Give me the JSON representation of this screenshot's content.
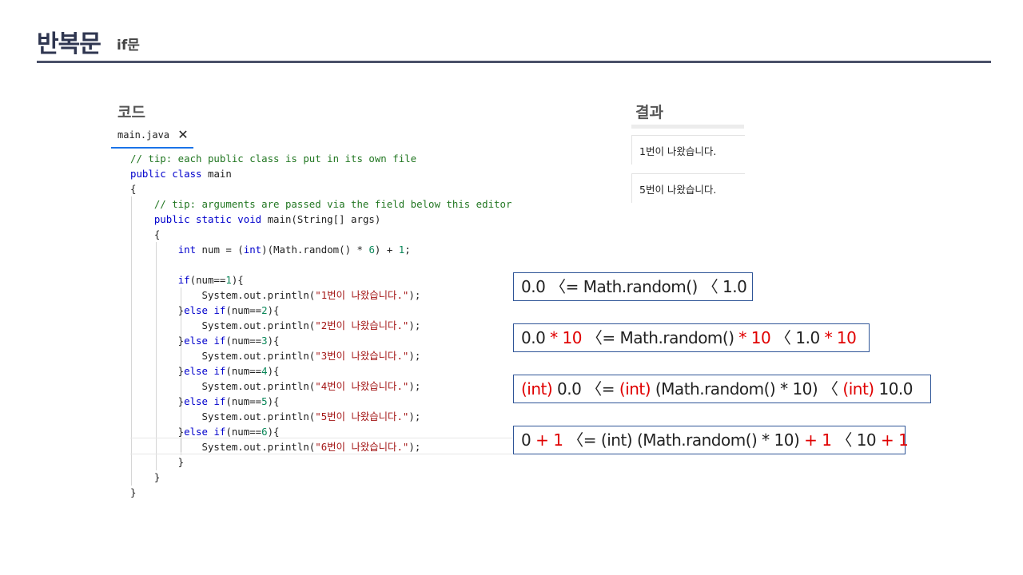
{
  "slide": {
    "title": "반복문",
    "subtitle": "if문"
  },
  "sections": {
    "code_label": "코드",
    "result_label": "결과"
  },
  "editor": {
    "tab_name": "main.java",
    "close_icon": "close-icon",
    "lines": [
      [
        {
          "t": "// tip: each public class is put in its own file",
          "c": "cm"
        }
      ],
      [
        {
          "t": "public class",
          "c": "kw"
        },
        {
          "t": " main",
          "c": ""
        }
      ],
      [
        {
          "t": "{",
          "c": ""
        }
      ],
      [
        {
          "t": "    ",
          "c": ""
        },
        {
          "t": "// tip: arguments are passed via the field below this editor",
          "c": "cm"
        }
      ],
      [
        {
          "t": "    ",
          "c": ""
        },
        {
          "t": "public static void",
          "c": "kw"
        },
        {
          "t": " main(String[] args)",
          "c": ""
        }
      ],
      [
        {
          "t": "    {",
          "c": ""
        }
      ],
      [
        {
          "t": "        ",
          "c": ""
        },
        {
          "t": "int",
          "c": "kw"
        },
        {
          "t": " num = (",
          "c": ""
        },
        {
          "t": "int",
          "c": "kw"
        },
        {
          "t": ")(Math.random() * ",
          "c": ""
        },
        {
          "t": "6",
          "c": "num"
        },
        {
          "t": ") + ",
          "c": ""
        },
        {
          "t": "1",
          "c": "num"
        },
        {
          "t": ";",
          "c": ""
        }
      ],
      [
        {
          "t": "",
          "c": ""
        }
      ],
      [
        {
          "t": "        ",
          "c": ""
        },
        {
          "t": "if",
          "c": "kw"
        },
        {
          "t": "(num==",
          "c": ""
        },
        {
          "t": "1",
          "c": "num"
        },
        {
          "t": "){",
          "c": ""
        }
      ],
      [
        {
          "t": "            System.out.println(",
          "c": ""
        },
        {
          "t": "\"1번이 나왔습니다.\"",
          "c": "str"
        },
        {
          "t": ");",
          "c": ""
        }
      ],
      [
        {
          "t": "        }",
          "c": ""
        },
        {
          "t": "else if",
          "c": "kw"
        },
        {
          "t": "(num==",
          "c": ""
        },
        {
          "t": "2",
          "c": "num"
        },
        {
          "t": "){",
          "c": ""
        }
      ],
      [
        {
          "t": "            System.out.println(",
          "c": ""
        },
        {
          "t": "\"2번이 나왔습니다.\"",
          "c": "str"
        },
        {
          "t": ");",
          "c": ""
        }
      ],
      [
        {
          "t": "        }",
          "c": ""
        },
        {
          "t": "else if",
          "c": "kw"
        },
        {
          "t": "(num==",
          "c": ""
        },
        {
          "t": "3",
          "c": "num"
        },
        {
          "t": "){",
          "c": ""
        }
      ],
      [
        {
          "t": "            System.out.println(",
          "c": ""
        },
        {
          "t": "\"3번이 나왔습니다.\"",
          "c": "str"
        },
        {
          "t": ");",
          "c": ""
        }
      ],
      [
        {
          "t": "        }",
          "c": ""
        },
        {
          "t": "else if",
          "c": "kw"
        },
        {
          "t": "(num==",
          "c": ""
        },
        {
          "t": "4",
          "c": "num"
        },
        {
          "t": "){",
          "c": ""
        }
      ],
      [
        {
          "t": "            System.out.println(",
          "c": ""
        },
        {
          "t": "\"4번이 나왔습니다.\"",
          "c": "str"
        },
        {
          "t": ");",
          "c": ""
        }
      ],
      [
        {
          "t": "        }",
          "c": ""
        },
        {
          "t": "else if",
          "c": "kw"
        },
        {
          "t": "(num==",
          "c": ""
        },
        {
          "t": "5",
          "c": "num"
        },
        {
          "t": "){",
          "c": ""
        }
      ],
      [
        {
          "t": "            System.out.println(",
          "c": ""
        },
        {
          "t": "\"5번이 나왔습니다.\"",
          "c": "str"
        },
        {
          "t": ");",
          "c": ""
        }
      ],
      [
        {
          "t": "        }",
          "c": ""
        },
        {
          "t": "else if",
          "c": "kw"
        },
        {
          "t": "(num==",
          "c": ""
        },
        {
          "t": "6",
          "c": "num"
        },
        {
          "t": "){",
          "c": ""
        }
      ],
      [
        {
          "t": "            System.out.println(",
          "c": ""
        },
        {
          "t": "\"6번이 나왔습니다.\"",
          "c": "str"
        },
        {
          "t": ");",
          "c": ""
        }
      ],
      [
        {
          "t": "        }",
          "c": ""
        }
      ],
      [
        {
          "t": "    }",
          "c": ""
        }
      ],
      [
        {
          "t": "}",
          "c": ""
        }
      ]
    ]
  },
  "results": [
    "1번이 나왔습니다.",
    "5번이 나왔습니다."
  ],
  "equations": [
    [
      {
        "t": "0.0 〈= Math.random() 〈 1.0",
        "c": ""
      }
    ],
    [
      {
        "t": "0.0 ",
        "c": ""
      },
      {
        "t": "* 10",
        "c": "red"
      },
      {
        "t": " 〈= Math.random() ",
        "c": ""
      },
      {
        "t": "* 10",
        "c": "red"
      },
      {
        "t": " 〈 1.0 ",
        "c": ""
      },
      {
        "t": "* 10",
        "c": "red"
      }
    ],
    [
      {
        "t": "(int)",
        "c": "red"
      },
      {
        "t": " 0.0 〈= ",
        "c": ""
      },
      {
        "t": "(int)",
        "c": "red"
      },
      {
        "t": " (Math.random() * 10) 〈 ",
        "c": ""
      },
      {
        "t": "(int)",
        "c": "red"
      },
      {
        "t": " 10.0",
        "c": ""
      }
    ],
    [
      {
        "t": "0 ",
        "c": ""
      },
      {
        "t": "+ 1",
        "c": "red"
      },
      {
        "t": " 〈= (int) (Math.random() * 10) ",
        "c": ""
      },
      {
        "t": "+ 1",
        "c": "red"
      },
      {
        "t": " 〈 10 ",
        "c": ""
      },
      {
        "t": "+ 1",
        "c": "red"
      }
    ]
  ],
  "colors": {
    "accent": "#1a73e8",
    "title": "#2f3650",
    "box_border": "#2f5597",
    "emphasis": "#e00000"
  }
}
